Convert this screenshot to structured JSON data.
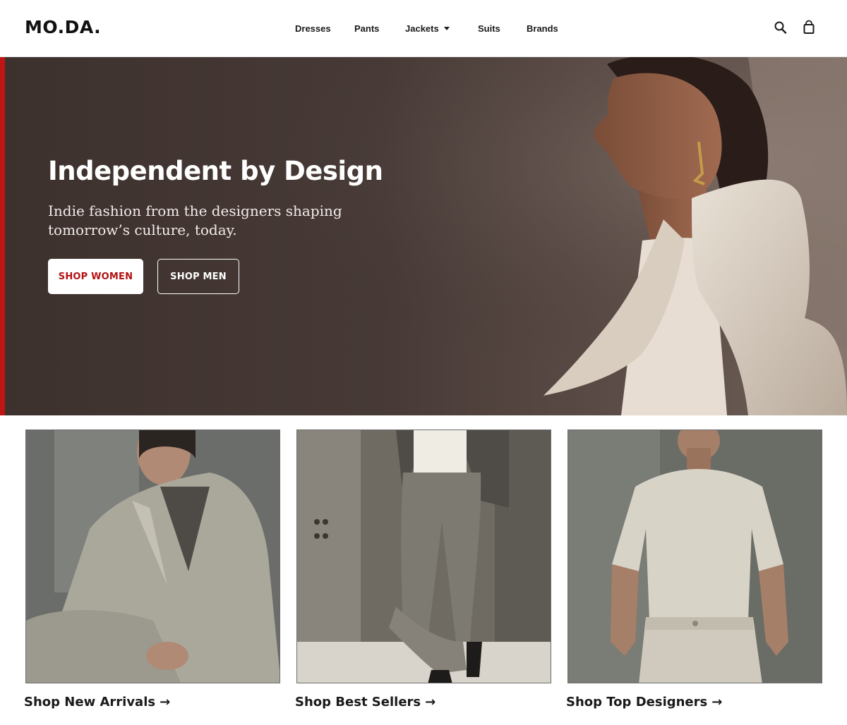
{
  "brand": {
    "logo": "MO.DA."
  },
  "nav": {
    "items": [
      {
        "label": "Dresses"
      },
      {
        "label": "Pants"
      },
      {
        "label": "Jackets",
        "has_dropdown": true
      },
      {
        "label": "Suits"
      },
      {
        "label": "Brands"
      }
    ]
  },
  "header_icons": {
    "search": "search-icon",
    "cart": "shopping-bag-icon"
  },
  "hero": {
    "title": "Independent by Design",
    "subtitle": "Indie fashion from the designers shaping tomorrow’s culture, today.",
    "primary_button": "SHOP WOMEN",
    "secondary_button": "SHOP MEN",
    "accent_color": "#c01515"
  },
  "cards": [
    {
      "label": "Shop New Arrivals",
      "arrow": "→"
    },
    {
      "label": "Shop Best Sellers",
      "arrow": "→"
    },
    {
      "label": "Shop Top Designers",
      "arrow": "→"
    }
  ]
}
